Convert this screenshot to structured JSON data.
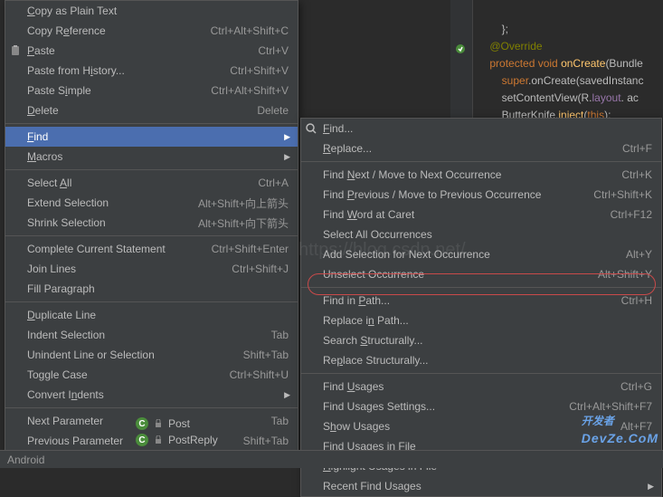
{
  "code": {
    "l1": "};",
    "l2": "@Override",
    "l3a": "protected void ",
    "l3b": "onCreate",
    "l3c": "(Bundle",
    "l4a": "super",
    "l4b": ".onCreate(savedInstanc",
    "l5a": "setContentView(R.",
    "l5b": "layout",
    "l5c": ". ac",
    "l6a": "ButterKnife.",
    "l6b": "inject",
    "l6c": "(",
    "l6d": "this",
    "l6e": ");"
  },
  "left_menu": [
    {
      "label": "Copy as Plain Text",
      "shortcut": "",
      "u": 0
    },
    {
      "label": "Copy Reference",
      "shortcut": "Ctrl+Alt+Shift+C",
      "u": 6
    },
    {
      "label": "Paste",
      "shortcut": "Ctrl+V",
      "icon": "paste",
      "u": 0
    },
    {
      "label": "Paste from History...",
      "shortcut": "Ctrl+Shift+V",
      "u": 12
    },
    {
      "label": "Paste Simple",
      "shortcut": "Ctrl+Alt+Shift+V",
      "u": 7
    },
    {
      "label": "Delete",
      "shortcut": "Delete",
      "u": 0
    },
    {
      "sep": true
    },
    {
      "label": "Find",
      "shortcut": "",
      "submenu": true,
      "highlighted": true,
      "u": 0
    },
    {
      "label": "Macros",
      "shortcut": "",
      "submenu": true,
      "u": 0
    },
    {
      "sep": true
    },
    {
      "label": "Select All",
      "shortcut": "Ctrl+A",
      "u": 7
    },
    {
      "label": "Extend Selection",
      "shortcut": "Alt+Shift+向上箭头"
    },
    {
      "label": "Shrink Selection",
      "shortcut": "Alt+Shift+向下箭头"
    },
    {
      "sep": true
    },
    {
      "label": "Complete Current Statement",
      "shortcut": "Ctrl+Shift+Enter"
    },
    {
      "label": "Join Lines",
      "shortcut": "Ctrl+Shift+J"
    },
    {
      "label": "Fill Paragraph",
      "shortcut": ""
    },
    {
      "sep": true
    },
    {
      "label": "Duplicate Line",
      "shortcut": "",
      "u": 0
    },
    {
      "label": "Indent Selection",
      "shortcut": "Tab"
    },
    {
      "label": "Unindent Line or Selection",
      "shortcut": "Shift+Tab"
    },
    {
      "label": "Toggle Case",
      "shortcut": "Ctrl+Shift+U"
    },
    {
      "label": "Convert Indents",
      "shortcut": "",
      "submenu": true,
      "u": 9
    },
    {
      "sep": true
    },
    {
      "label": "Next Parameter",
      "shortcut": "Tab"
    },
    {
      "label": "Previous Parameter",
      "shortcut": "Shift+Tab"
    }
  ],
  "right_menu": [
    {
      "label": "Find...",
      "shortcut": "",
      "icon": "search",
      "u": 0
    },
    {
      "label": "Replace...",
      "shortcut": "Ctrl+F",
      "u": 0
    },
    {
      "sep": true
    },
    {
      "label": "Find Next / Move to Next Occurrence",
      "shortcut": "Ctrl+K",
      "u": 5
    },
    {
      "label": "Find Previous / Move to Previous Occurrence",
      "shortcut": "Ctrl+Shift+K",
      "u": 5
    },
    {
      "label": "Find Word at Caret",
      "shortcut": "Ctrl+F12",
      "u": 5
    },
    {
      "label": "Select All Occurrences",
      "shortcut": ""
    },
    {
      "label": "Add Selection for Next Occurrence",
      "shortcut": "Alt+Y"
    },
    {
      "label": "Unselect Occurrence",
      "shortcut": "Alt+Shift+Y"
    },
    {
      "sep": true
    },
    {
      "label": "Find in Path...",
      "shortcut": "Ctrl+H",
      "u": 8,
      "circled": true
    },
    {
      "label": "Replace in Path...",
      "shortcut": "",
      "u": 9
    },
    {
      "label": "Search Structurally...",
      "shortcut": "",
      "u": 7
    },
    {
      "label": "Replace Structurally...",
      "shortcut": "",
      "u": 2
    },
    {
      "sep": true
    },
    {
      "label": "Find Usages",
      "shortcut": "Ctrl+G",
      "u": 5
    },
    {
      "label": "Find Usages Settings...",
      "shortcut": "Ctrl+Alt+Shift+F7"
    },
    {
      "label": "Show Usages",
      "shortcut": "Alt+F7",
      "u": 1
    },
    {
      "label": "Find Usages in File",
      "shortcut": "",
      "u": 15
    },
    {
      "label": "Highlight Usages in File",
      "shortcut": "",
      "u": 0
    },
    {
      "label": "Recent Find Usages",
      "shortcut": "",
      "submenu": true
    }
  ],
  "bottom": {
    "post": "Post",
    "postreply": "PostReply",
    "status": "Android"
  },
  "watermark": {
    "title": "开发者",
    "sub": "DevZe.CoM"
  },
  "watermark2": "https://blog.csdn.net/"
}
